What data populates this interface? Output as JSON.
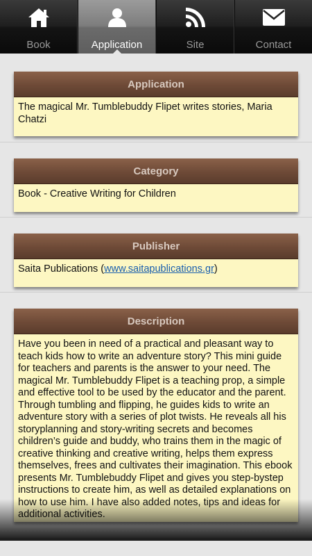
{
  "tabs": [
    {
      "label": "Book",
      "icon": "home-icon",
      "active": false
    },
    {
      "label": "Application",
      "icon": "person-icon",
      "active": true
    },
    {
      "label": "Site",
      "icon": "rss-icon",
      "active": false
    },
    {
      "label": "Contact",
      "icon": "envelope-icon",
      "active": false
    }
  ],
  "sections": {
    "application": {
      "title": "Application",
      "text": "The magical Mr. Tumblebuddy Flipet writes stories, Maria Chatzi"
    },
    "category": {
      "title": "Category",
      "text": "Book - Creative Writing for Children"
    },
    "publisher": {
      "title": "Publisher",
      "text_before": "Saita Publications (",
      "link": "www.saitapublications.gr",
      "text_after": ")"
    },
    "description": {
      "title": "Description",
      "text": "Have you been in need of a practical and pleasant way to teach kids how to write an adventure story? This mini guide for teachers and parents is the answer to your need. The magical Mr. Tumblebuddy Flipet is a teaching prop, a simple and effective tool to be used by the educator and the parent. Through tumbling and flipping, he guides kids to write an adventure story with a series of plot twists. He reveals all his storyplanning and story-writing secrets and becomes children’s guide and buddy, who trains them in the magic of creative thinking and creative writing, helps them express themselves, frees and cultivates their imagination. This ebook presents Mr. Tumblebuddy Flipet and gives you step-bystep instructions to create him, as well as detailed explanations on how to use him. I have also added notes, tips and ideas for additional activities."
    }
  },
  "colors": {
    "header_brown": "#6e4a37",
    "body_yellow": "#fdf7c2",
    "link_blue": "#1a5fae",
    "active_tab": "#7d7d7d"
  }
}
